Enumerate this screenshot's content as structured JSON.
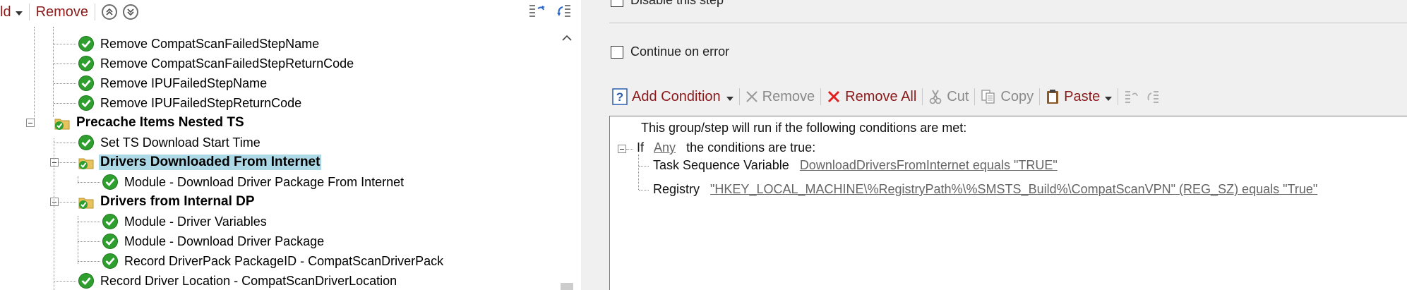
{
  "left_toolbar": {
    "add_partial": "ld",
    "remove_label": "Remove"
  },
  "tree": {
    "items": [
      {
        "label": "Remove CompatScanFailedStepName",
        "bold": false,
        "icon": "green-check-icon"
      },
      {
        "label": "Remove CompatScanFailedStepReturnCode",
        "bold": false,
        "icon": "green-check-icon"
      },
      {
        "label": "Remove IPUFailedStepName",
        "bold": false,
        "icon": "green-check-icon"
      },
      {
        "label": "Remove IPUFailedStepReturnCode",
        "bold": false,
        "icon": "green-check-icon"
      },
      {
        "label": "Precache Items Nested TS",
        "bold": true,
        "icon": "folder-check-icon"
      },
      {
        "label": "Set TS Download Start Time",
        "bold": false,
        "icon": "green-check-icon"
      },
      {
        "label": "Drivers Downloaded From Internet",
        "bold": true,
        "icon": "folder-check-icon",
        "selected": true
      },
      {
        "label": "Module - Download Driver Package From Internet",
        "bold": false,
        "icon": "green-check-icon"
      },
      {
        "label": "Drivers from Internal DP",
        "bold": true,
        "icon": "folder-check-icon"
      },
      {
        "label": "Module - Driver Variables",
        "bold": false,
        "icon": "green-check-icon"
      },
      {
        "label": "Module - Download Driver Package",
        "bold": false,
        "icon": "green-check-icon"
      },
      {
        "label": "Record DriverPack PackageID - CompatScanDriverPack",
        "bold": false,
        "icon": "green-check-icon"
      },
      {
        "label": "Record Driver Location - CompatScanDriverLocation",
        "bold": false,
        "icon": "green-check-icon"
      }
    ]
  },
  "options": {
    "disable_step_label": "Disable this step",
    "continue_on_error_label": "Continue on error"
  },
  "condition_toolbar": {
    "add_condition": "Add Condition",
    "remove": "Remove",
    "remove_all": "Remove All",
    "cut": "Cut",
    "copy": "Copy",
    "paste": "Paste"
  },
  "conditions": {
    "intro": "This group/step will run if the following conditions are met:",
    "if_label": "If",
    "any_link": "Any",
    "if_suffix": "the conditions are true:",
    "rows": [
      {
        "type": "Task Sequence Variable",
        "value": "DownloadDriversFromInternet equals \"TRUE\""
      },
      {
        "type": "Registry",
        "value": "\"HKEY_LOCAL_MACHINE\\%RegistryPath%\\%SMSTS_Build%\\CompatScanVPN\" (REG_SZ) equals \"True\""
      }
    ]
  },
  "colors": {
    "toolbar_text": "#8b1a1a",
    "selection": "#add8e6",
    "check_green": "#2e9e2e",
    "remove_all_x": "#e02020"
  }
}
